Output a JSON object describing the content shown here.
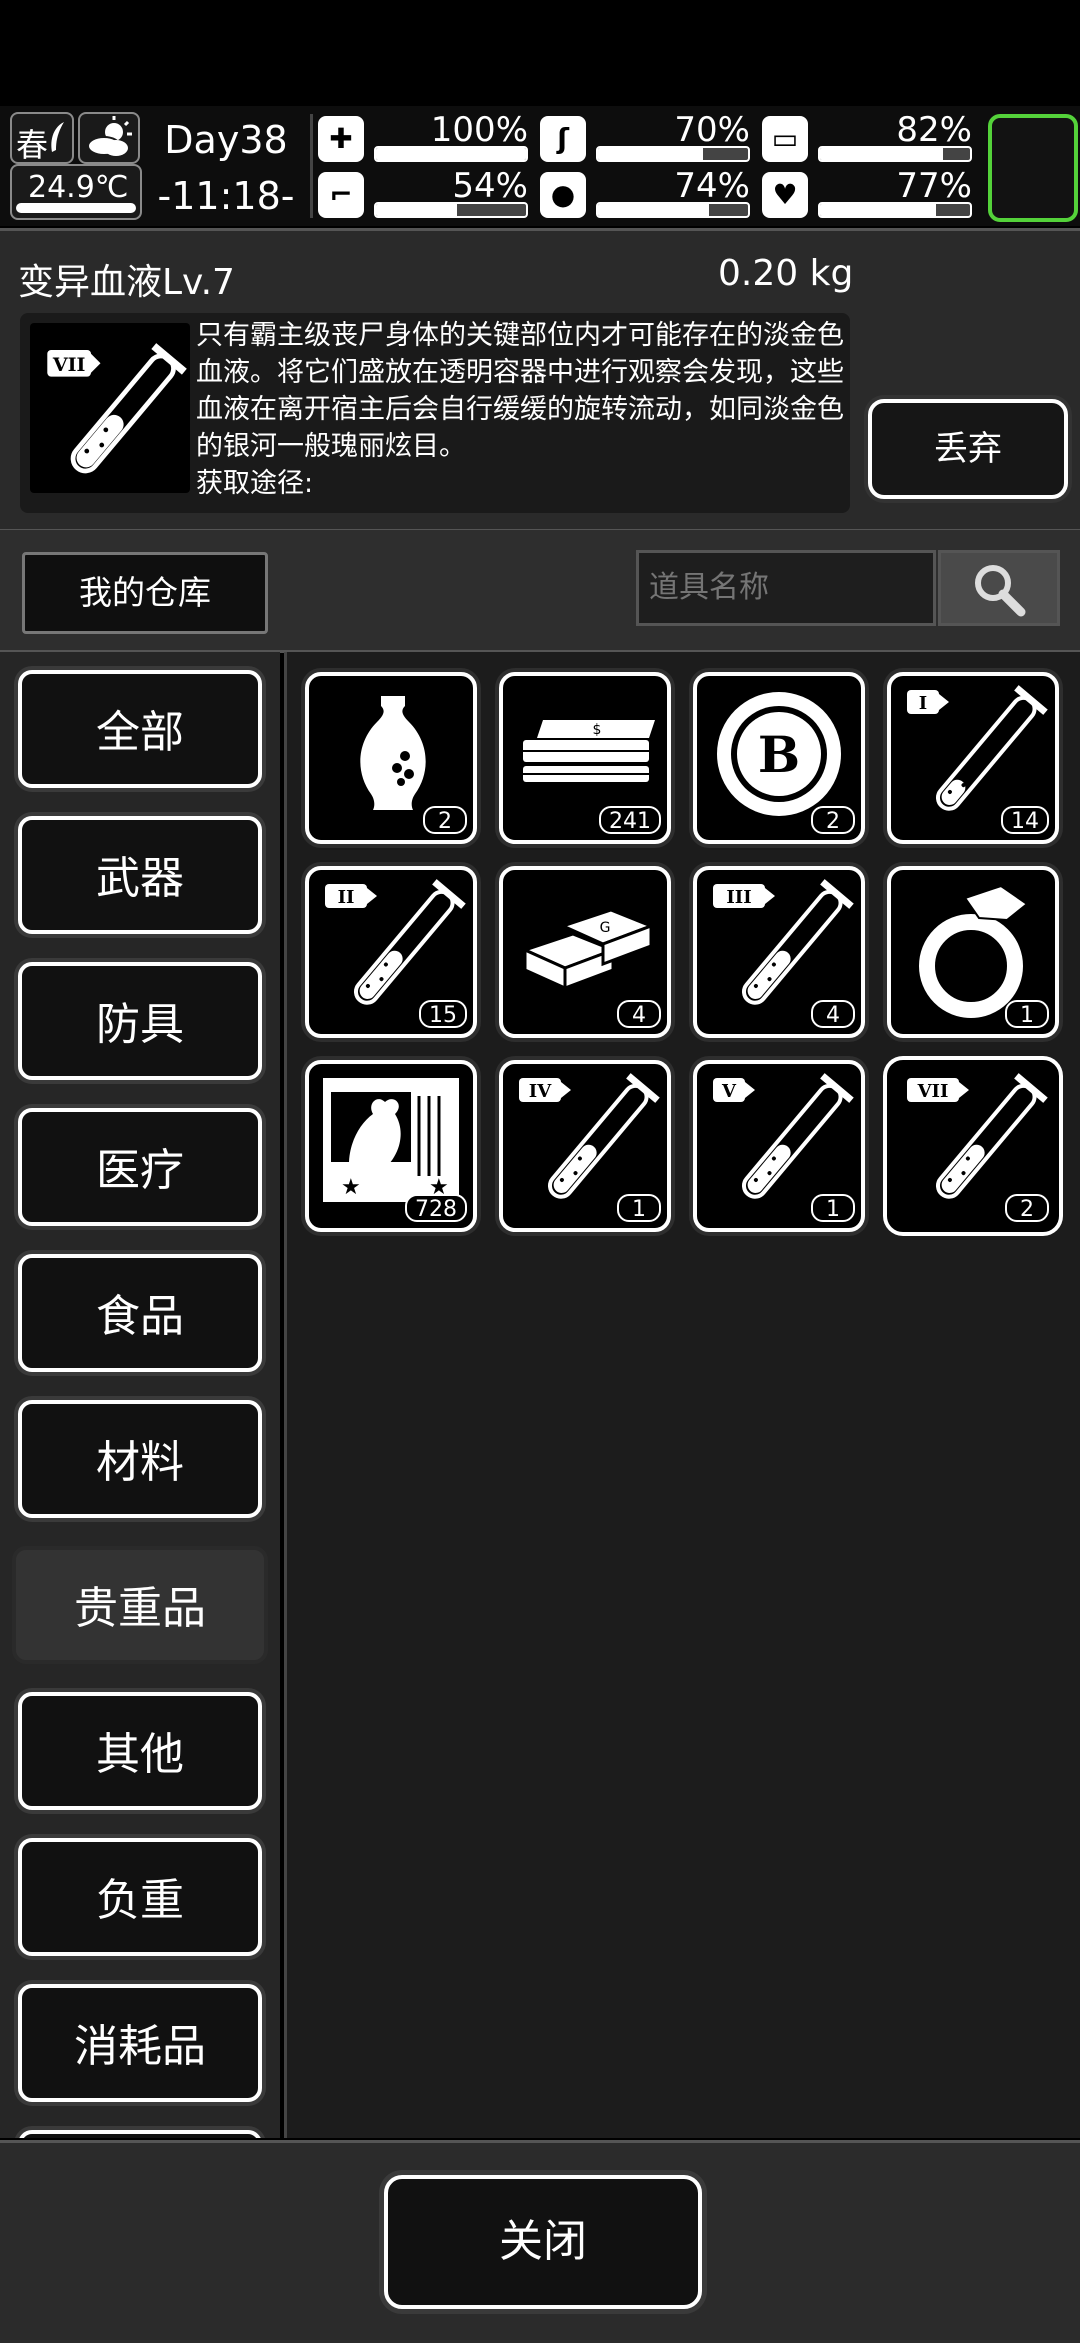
{
  "status": {
    "season": "春",
    "temperature": "24.9℃",
    "day": "Day38",
    "time": "-11:18-",
    "stats": [
      {
        "icon": "medkit-icon",
        "value_text": "100%",
        "level": 1.0
      },
      {
        "icon": "stomach-icon",
        "value_text": "70%",
        "level": 0.7
      },
      {
        "icon": "pill-icon",
        "value_text": "82%",
        "level": 0.82
      },
      {
        "icon": "boot-icon",
        "value_text": "54%",
        "level": 0.54
      },
      {
        "icon": "water-drop-icon",
        "value_text": "74%",
        "level": 0.74
      },
      {
        "icon": "heart-icon",
        "value_text": "77%",
        "level": 0.77
      }
    ]
  },
  "detail": {
    "name": "变异血液Lv.7",
    "weight": "0.20 kg",
    "description": "只有霸主级丧尸身体的关键部位内才可能存在的淡金色血液。将它们盛放在透明容器中进行观察会发现，这些血液在离开宿主后会自行缓缓的旋转流动，如同淡金色的银河一般瑰丽炫目。",
    "source_label": "获取途径:",
    "drop_label": "丢弃",
    "icon_badge": "VII"
  },
  "warehouse": {
    "label": "我的仓库",
    "search_placeholder": "道具名称"
  },
  "categories": [
    {
      "label": "全部",
      "active": false
    },
    {
      "label": "武器",
      "active": false
    },
    {
      "label": "防具",
      "active": false
    },
    {
      "label": "医疗",
      "active": false
    },
    {
      "label": "食品",
      "active": false
    },
    {
      "label": "材料",
      "active": false
    },
    {
      "label": "贵重品",
      "active": true
    },
    {
      "label": "其他",
      "active": false
    },
    {
      "label": "负重",
      "active": false
    },
    {
      "label": "消耗品",
      "active": false
    }
  ],
  "items": [
    {
      "icon": "vase-icon",
      "qty": "2"
    },
    {
      "icon": "cash-stack-icon",
      "qty": "241"
    },
    {
      "icon": "bitcoin-icon",
      "qty": "2"
    },
    {
      "icon": "test-tube-icon",
      "badge": "I",
      "qty": "14"
    },
    {
      "icon": "test-tube-icon",
      "badge": "II",
      "qty": "15"
    },
    {
      "icon": "gold-bars-icon",
      "qty": "4"
    },
    {
      "icon": "test-tube-icon",
      "badge": "III",
      "qty": "4"
    },
    {
      "icon": "diamond-ring-icon",
      "qty": "1"
    },
    {
      "icon": "painting-icon",
      "qty": "728"
    },
    {
      "icon": "test-tube-icon",
      "badge": "IV",
      "qty": "1"
    },
    {
      "icon": "test-tube-icon",
      "badge": "V",
      "qty": "1"
    },
    {
      "icon": "test-tube-icon",
      "badge": "VII",
      "qty": "2",
      "selected": true
    }
  ],
  "footer": {
    "close_label": "关闭"
  }
}
